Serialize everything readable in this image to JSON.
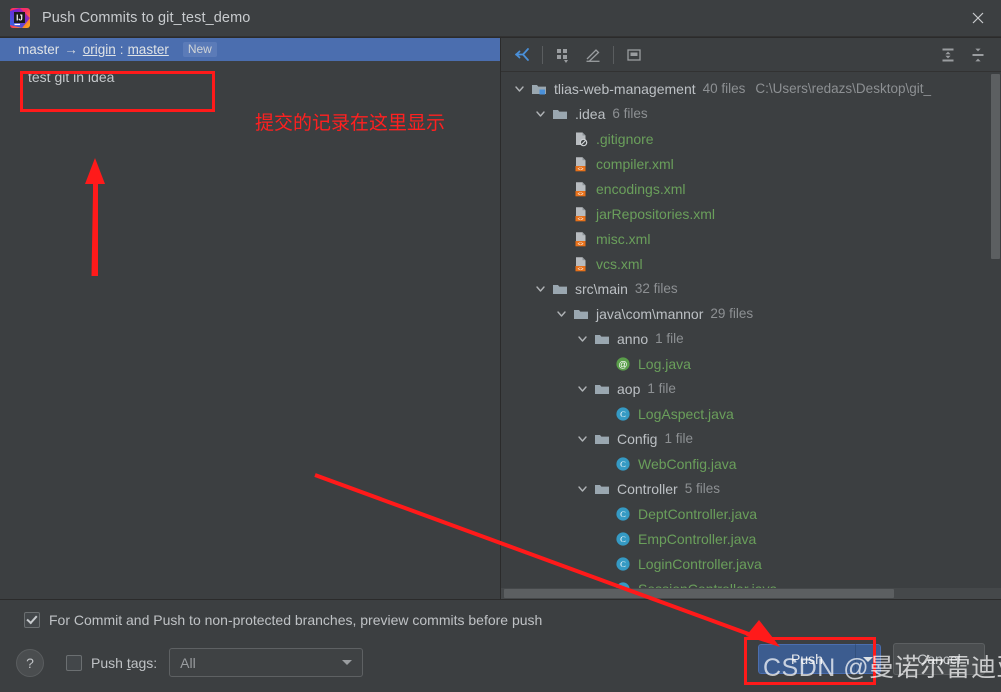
{
  "window": {
    "title": "Push Commits to git_test_demo",
    "logo_icon": "intellij-idea-logo",
    "close_icon": "close-icon"
  },
  "left_panel": {
    "branch": {
      "local": "master",
      "arrow": "→",
      "remote": "origin",
      "separator": ":",
      "remote_branch": "master",
      "badge": "New"
    },
    "commits": [
      {
        "message": "test git in idea"
      }
    ]
  },
  "right_panel": {
    "toolbar": [
      {
        "name": "collapse-changes-icon",
        "label": ""
      },
      {
        "name": "group-by-icon",
        "label": ""
      },
      {
        "name": "edit-icon",
        "label": ""
      },
      {
        "name": "preview-diff-icon",
        "label": ""
      },
      {
        "name": "expand-all-icon",
        "label": ""
      },
      {
        "name": "collapse-all-icon",
        "label": ""
      }
    ],
    "tree": [
      {
        "depth": 0,
        "type": "root",
        "expanded": true,
        "icon": "module-folder-icon",
        "label": "tlias-web-management",
        "count": "40 files",
        "path": "C:\\Users\\redazs\\Desktop\\git_"
      },
      {
        "depth": 1,
        "type": "folder",
        "expanded": true,
        "icon": "folder-icon",
        "label": ".idea",
        "count": "6 files",
        "path": ""
      },
      {
        "depth": 2,
        "type": "file",
        "expanded": null,
        "icon": "gitignore-file-icon",
        "label": ".gitignore",
        "count": "",
        "path": ""
      },
      {
        "depth": 2,
        "type": "file",
        "expanded": null,
        "icon": "xml-file-icon",
        "label": "compiler.xml",
        "count": "",
        "path": ""
      },
      {
        "depth": 2,
        "type": "file",
        "expanded": null,
        "icon": "xml-file-icon",
        "label": "encodings.xml",
        "count": "",
        "path": ""
      },
      {
        "depth": 2,
        "type": "file",
        "expanded": null,
        "icon": "xml-file-icon",
        "label": "jarRepositories.xml",
        "count": "",
        "path": ""
      },
      {
        "depth": 2,
        "type": "file",
        "expanded": null,
        "icon": "xml-file-icon",
        "label": "misc.xml",
        "count": "",
        "path": ""
      },
      {
        "depth": 2,
        "type": "file",
        "expanded": null,
        "icon": "xml-file-icon",
        "label": "vcs.xml",
        "count": "",
        "path": ""
      },
      {
        "depth": 1,
        "type": "folder",
        "expanded": true,
        "icon": "folder-icon",
        "label": "src\\main",
        "count": "32 files",
        "path": ""
      },
      {
        "depth": 2,
        "type": "folder",
        "expanded": true,
        "icon": "folder-icon",
        "label": "java\\com\\mannor",
        "count": "29 files",
        "path": ""
      },
      {
        "depth": 3,
        "type": "folder",
        "expanded": true,
        "icon": "folder-icon",
        "label": "anno",
        "count": "1 file",
        "path": ""
      },
      {
        "depth": 4,
        "type": "file",
        "expanded": null,
        "icon": "annotation-java-icon",
        "label": "Log.java",
        "count": "",
        "path": ""
      },
      {
        "depth": 3,
        "type": "folder",
        "expanded": true,
        "icon": "folder-icon",
        "label": "aop",
        "count": "1 file",
        "path": ""
      },
      {
        "depth": 4,
        "type": "file",
        "expanded": null,
        "icon": "java-class-icon",
        "label": "LogAspect.java",
        "count": "",
        "path": ""
      },
      {
        "depth": 3,
        "type": "folder",
        "expanded": true,
        "icon": "folder-icon",
        "label": "Config",
        "count": "1 file",
        "path": ""
      },
      {
        "depth": 4,
        "type": "file",
        "expanded": null,
        "icon": "java-class-icon",
        "label": "WebConfig.java",
        "count": "",
        "path": ""
      },
      {
        "depth": 3,
        "type": "folder",
        "expanded": true,
        "icon": "folder-icon",
        "label": "Controller",
        "count": "5 files",
        "path": ""
      },
      {
        "depth": 4,
        "type": "file",
        "expanded": null,
        "icon": "java-class-icon",
        "label": "DeptController.java",
        "count": "",
        "path": ""
      },
      {
        "depth": 4,
        "type": "file",
        "expanded": null,
        "icon": "java-class-icon",
        "label": "EmpController.java",
        "count": "",
        "path": ""
      },
      {
        "depth": 4,
        "type": "file",
        "expanded": null,
        "icon": "java-class-icon",
        "label": "LoginController.java",
        "count": "",
        "path": ""
      },
      {
        "depth": 4,
        "type": "file",
        "expanded": null,
        "icon": "java-class-icon",
        "label": "SessionController.java",
        "count": "",
        "path": ""
      }
    ]
  },
  "bottom": {
    "preview_checkbox": {
      "label": "For Commit and Push to non-protected branches, preview commits before push",
      "checked": true
    },
    "help_label": "?",
    "push_tags": {
      "label_before": "Push ",
      "label_mnemonic": "t",
      "label_after": "ags:",
      "checked": false,
      "select_value": "All"
    },
    "push_button": "Push",
    "cancel_button": "Cancel"
  },
  "annotations": {
    "commit_note": "提交的记录在这里显示",
    "watermark": "CSDN @曼诺尔雷迪亚兹",
    "accent_color": "#ff1a1a"
  }
}
